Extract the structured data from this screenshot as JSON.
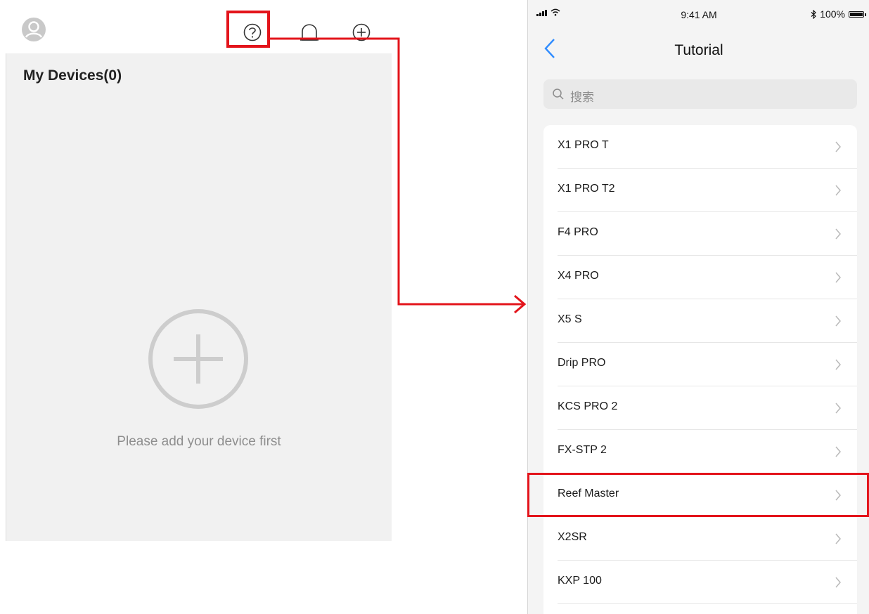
{
  "left": {
    "title": "My Devices(0)",
    "empty_message": "Please add your device first",
    "icons": [
      "avatar-icon",
      "help-icon",
      "notification-bell-icon",
      "add-circle-icon",
      "add-device-large-icon"
    ]
  },
  "right": {
    "status": {
      "time": "9:41 AM",
      "battery": "100%"
    },
    "nav_title": "Tutorial",
    "search_placeholder": "搜索",
    "items": [
      {
        "label": "X1 PRO T"
      },
      {
        "label": "X1 PRO T2"
      },
      {
        "label": "F4 PRO"
      },
      {
        "label": "X4 PRO"
      },
      {
        "label": "X5 S"
      },
      {
        "label": "Drip PRO"
      },
      {
        "label": "KCS PRO 2"
      },
      {
        "label": "FX-STP 2"
      },
      {
        "label": "Reef Master"
      },
      {
        "label": "X2SR"
      },
      {
        "label": "KXP 100"
      }
    ]
  },
  "colors": {
    "highlight": "#e3141b",
    "ios_blue": "#2f8cff"
  }
}
